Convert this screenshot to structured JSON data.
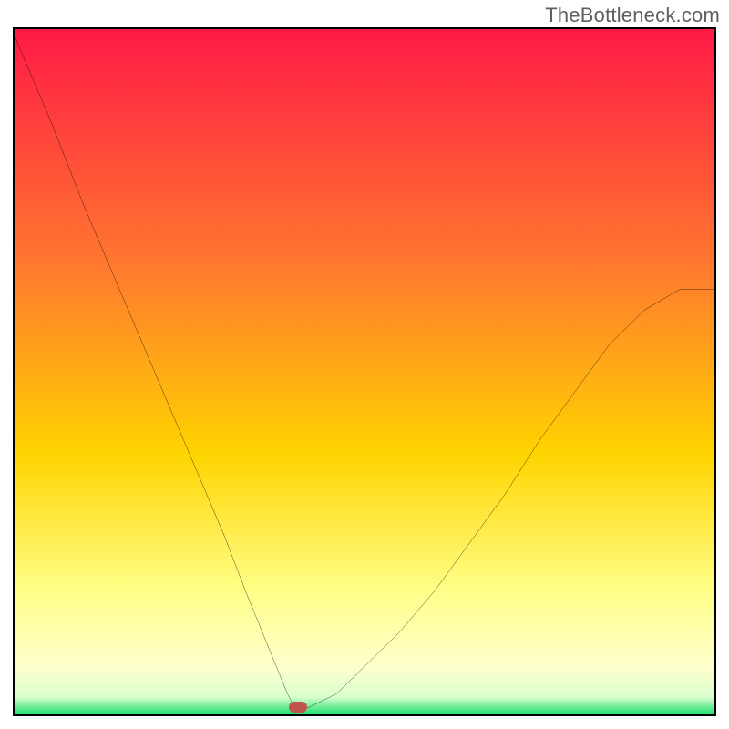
{
  "watermark": "TheBottleneck.com",
  "colors": {
    "border": "#000000",
    "curve": "#000000",
    "dot": "#c0534b",
    "gradient_top": "#ff1a46",
    "gradient_mid_upper": "#ff7a2e",
    "gradient_mid": "#ffd400",
    "gradient_soft_yellow": "#ffff88",
    "gradient_bottom_band": "#ffffcc",
    "gradient_bottom": "#1dde6c"
  },
  "chart_data": {
    "type": "line",
    "title": "",
    "xlabel": "",
    "ylabel": "",
    "xlim": [
      0,
      100
    ],
    "ylim": [
      0,
      100
    ],
    "grid": false,
    "legend": false,
    "notch_x": 40,
    "dot": {
      "x": 40.5,
      "y": 1
    },
    "series": [
      {
        "name": "curve",
        "x": [
          0,
          5,
          10,
          15,
          20,
          25,
          30,
          33,
          35,
          37,
          39,
          40,
          42,
          44,
          46,
          48,
          50,
          55,
          60,
          65,
          70,
          75,
          80,
          85,
          90,
          95,
          100
        ],
        "values": [
          99,
          87,
          74,
          62,
          50,
          38,
          26,
          18,
          13,
          8,
          3,
          1,
          1,
          2,
          3,
          5,
          7,
          12,
          18,
          25,
          32,
          40,
          47,
          54,
          59,
          62,
          62
        ]
      }
    ]
  }
}
